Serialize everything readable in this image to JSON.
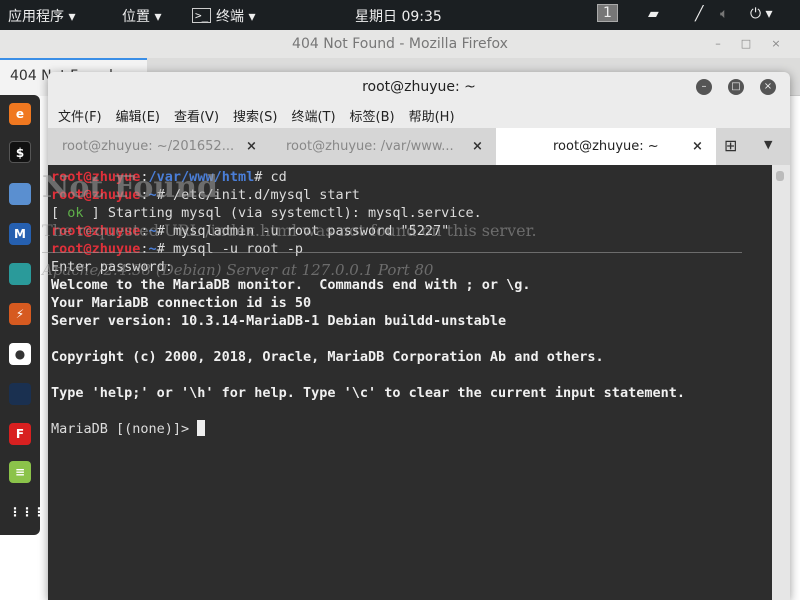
{
  "topbar": {
    "apps": "应用程序 ▾",
    "places": "位置 ▾",
    "terminal": "终端 ▾",
    "clock": "星期日 09:35",
    "workspace": "1"
  },
  "firefox": {
    "title": "404 Not Found - Mozilla Firefox",
    "tab": "404 Not Found",
    "page_heading": "Not Found",
    "page_text": "The requested URL /index.html was not found on this server.",
    "page_footer": "Apache/2.4.38 (Debian) Server at 127.0.0.1 Port 80"
  },
  "terminal": {
    "title": "root@zhuyue: ~",
    "menu": [
      "文件(F)",
      "编辑(E)",
      "查看(V)",
      "搜索(S)",
      "终端(T)",
      "标签(B)",
      "帮助(H)"
    ],
    "tabs": [
      "root@zhuyue: ~/201652...",
      "root@zhuyue: /var/www...",
      "root@zhuyue: ~"
    ],
    "user": "root@zhuyue",
    "lines": [
      {
        "path": "/var/www/html",
        "cmd": "# cd"
      },
      {
        "path": "~",
        "cmd": "# /etc/init.d/mysql start"
      },
      {
        "ok": "ok",
        "text": " ] Starting mysql (via systemctl): mysql.service."
      },
      {
        "path": "~",
        "cmd": "# mysqladmin -u root password \"5227\""
      },
      {
        "path": "~",
        "cmd": "# mysql -u root -p"
      }
    ],
    "output": [
      "Enter password:"
    ],
    "bold_output": [
      "Welcome to the MariaDB monitor.  Commands end with ; or \\g.",
      "Your MariaDB connection id is 50",
      "Server version: 10.3.14-MariaDB-1 Debian buildd-unstable",
      "",
      "Copyright (c) 2000, 2018, Oracle, MariaDB Corporation Ab and others.",
      "",
      "Type 'help;' or '\\h' for help. Type '\\c' to clear the current input statement.",
      ""
    ],
    "prompt": "MariaDB [(none)]> "
  }
}
